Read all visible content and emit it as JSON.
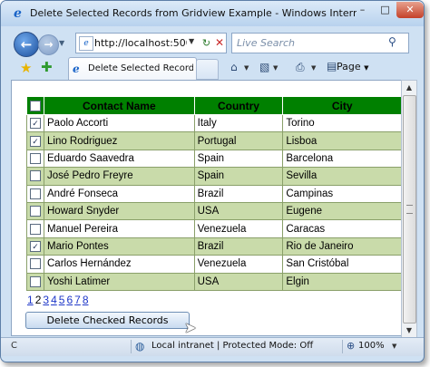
{
  "window": {
    "title": "Delete Selected Records from Gridview Example - Windows Internet Explorer",
    "minimize": "–",
    "maximize": "□",
    "close": "✕"
  },
  "nav": {
    "address_value": "http://localhost:500",
    "search_placeholder": "Live Search"
  },
  "tab": {
    "label": "Delete Selected Records ..."
  },
  "commands": {
    "page_label": "Page"
  },
  "grid": {
    "columns": [
      "Contact Name",
      "Country",
      "City"
    ],
    "rows": [
      {
        "checked": true,
        "name": "Paolo Accorti",
        "country": "Italy",
        "city": "Torino"
      },
      {
        "checked": true,
        "name": "Lino Rodriguez",
        "country": "Portugal",
        "city": "Lisboa"
      },
      {
        "checked": false,
        "name": "Eduardo Saavedra",
        "country": "Spain",
        "city": "Barcelona"
      },
      {
        "checked": false,
        "name": "José Pedro Freyre",
        "country": "Spain",
        "city": "Sevilla"
      },
      {
        "checked": false,
        "name": "André Fonseca",
        "country": "Brazil",
        "city": "Campinas"
      },
      {
        "checked": false,
        "name": "Howard Snyder",
        "country": "USA",
        "city": "Eugene"
      },
      {
        "checked": false,
        "name": "Manuel Pereira",
        "country": "Venezuela",
        "city": "Caracas"
      },
      {
        "checked": true,
        "name": "Mario Pontes",
        "country": "Brazil",
        "city": "Rio de Janeiro"
      },
      {
        "checked": false,
        "name": "Carlos Hernández",
        "country": "Venezuela",
        "city": "San Cristóbal"
      },
      {
        "checked": false,
        "name": "Yoshi Latimer",
        "country": "USA",
        "city": "Elgin"
      }
    ],
    "pager": [
      "1",
      "2",
      "3",
      "4",
      "5",
      "6",
      "7",
      "8"
    ],
    "current_page": "2"
  },
  "actions": {
    "delete_label": "Delete Checked Records"
  },
  "status": {
    "left": "C",
    "zone": "Local intranet | Protected Mode: Off",
    "zoom": "100%"
  },
  "colors": {
    "header_bg": "#008000",
    "alt_row": "#c9dbaa"
  }
}
